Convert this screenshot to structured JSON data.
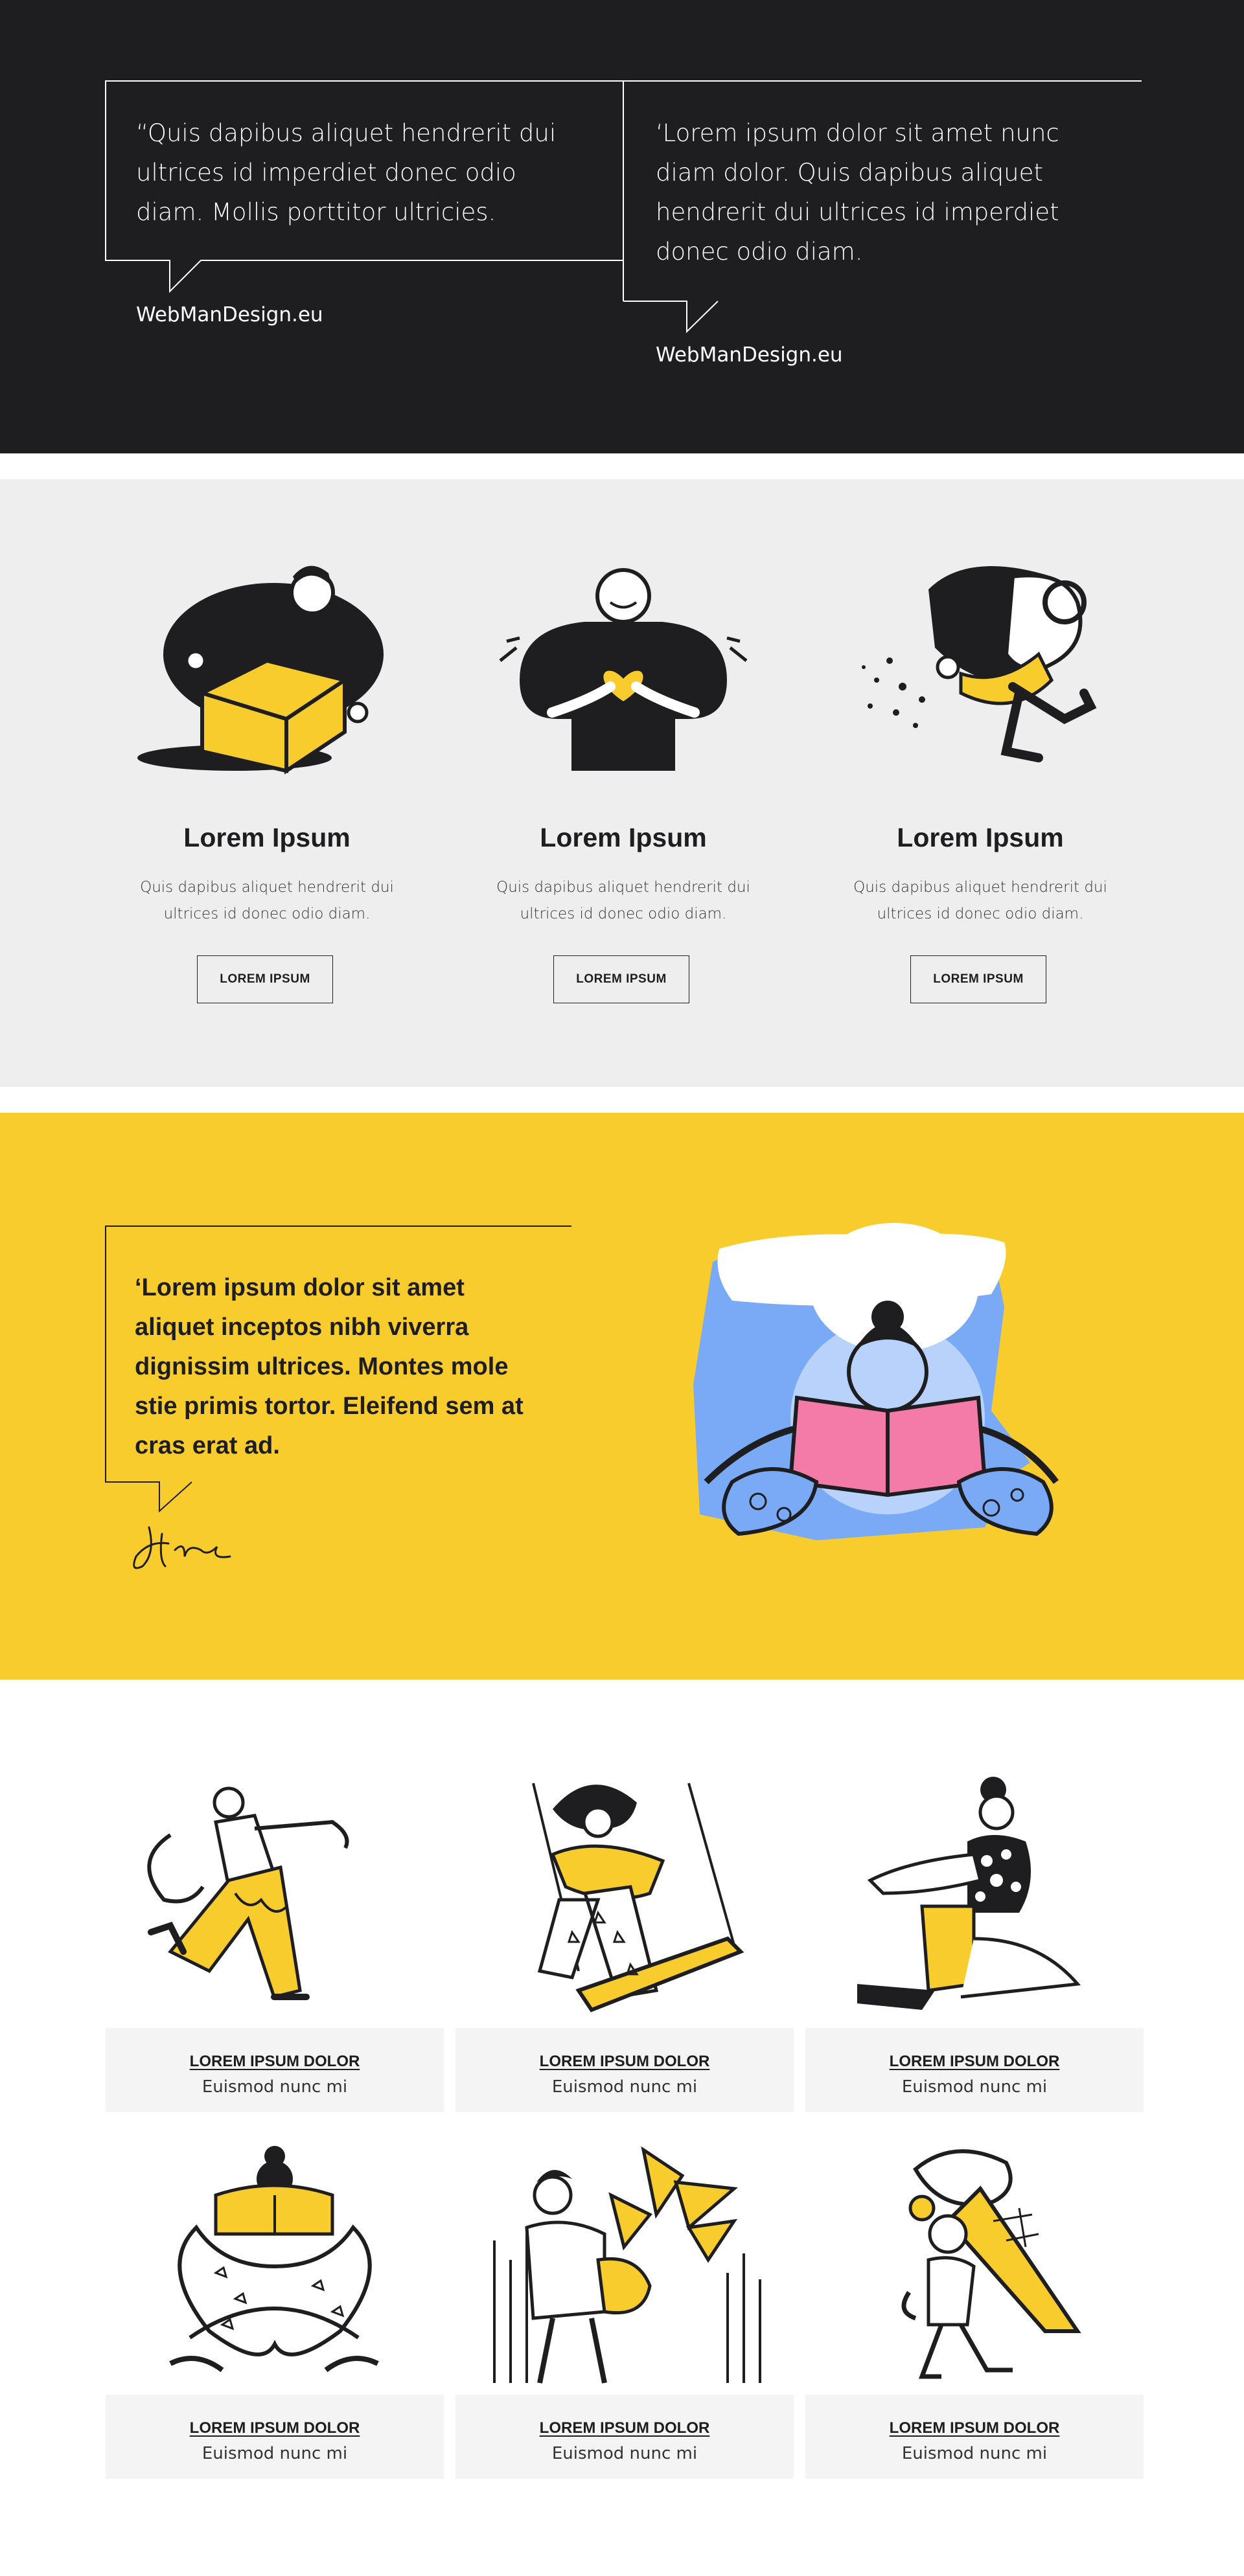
{
  "testimonials": [
    {
      "quote": "“Quis dapibus aliquet hendrerit dui ultrices id imperdiet donec odio diam. Mollis porttitor ultricies.",
      "author": "WebManDesign.eu"
    },
    {
      "quote": "‘Lorem ipsum dolor sit amet nunc diam dolor. Quis dapibus aliquet hendrerit dui ultrices id imperdiet donec odio diam.",
      "author": "WebManDesign.eu"
    }
  ],
  "services": [
    {
      "title": "Lorem Ipsum",
      "text": "Quis dapibus aliquet hendrerit dui ultrices id donec odio diam.",
      "button": "LOREM IPSUM",
      "icon": "person-with-box-illustration"
    },
    {
      "title": "Lorem Ipsum",
      "text": "Quis dapibus aliquet hendrerit dui ultrices id donec odio diam.",
      "button": "LOREM IPSUM",
      "icon": "person-with-heart-illustration"
    },
    {
      "title": "Lorem Ipsum",
      "text": "Quis dapibus aliquet hendrerit dui ultrices id donec odio diam.",
      "button": "LOREM IPSUM",
      "icon": "person-with-cup-illustration"
    }
  ],
  "feature_quote": {
    "text": "‘Lorem ipsum dolor sit amet aliquet inceptos nibh viverra dignissim ultrices. Montes mole stie primis tortor. Eleifend sem at cras erat ad.",
    "image": "person-reading-book-illustration"
  },
  "gallery": [
    {
      "title": "LOREM IPSUM DOLOR",
      "subtitle": "Euismod nunc mi",
      "image": "person-dancing-illustration"
    },
    {
      "title": "LOREM IPSUM DOLOR",
      "subtitle": "Euismod nunc mi",
      "image": "person-on-swing-illustration"
    },
    {
      "title": "LOREM IPSUM DOLOR",
      "subtitle": "Euismod nunc mi",
      "image": "person-sitting-illustration"
    },
    {
      "title": "LOREM IPSUM DOLOR",
      "subtitle": "Euismod nunc mi",
      "image": "person-reading-cross-legged-illustration"
    },
    {
      "title": "LOREM IPSUM DOLOR",
      "subtitle": "Euismod nunc mi",
      "image": "person-holding-plant-illustration"
    },
    {
      "title": "LOREM IPSUM DOLOR",
      "subtitle": "Euismod nunc mi",
      "image": "person-with-ice-cream-illustration"
    }
  ],
  "colors": {
    "dark": "#1e1e20",
    "light_gray": "#eeeeee",
    "yellow": "#f9cc2e",
    "blue": "#7aaaf5",
    "pink": "#f47aa8"
  }
}
